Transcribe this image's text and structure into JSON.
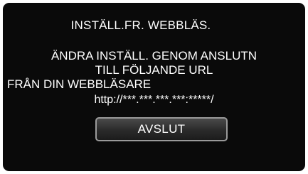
{
  "screen": {
    "title": "INSTÄLL.FR. WEBBLÄS.",
    "message": {
      "line1": "ÄNDRA INSTÄLL. GENOM ANSLUTN",
      "line2": "TILL FÖLJANDE URL",
      "line3": "FRÅN DIN WEBBLÄSARE"
    },
    "url": "http://***.***.***.***:*****/",
    "button_label": "AVSLUT"
  },
  "colors": {
    "background": "#0a0a0a",
    "text": "#ffffff",
    "button_border": "#9a9a9a"
  }
}
